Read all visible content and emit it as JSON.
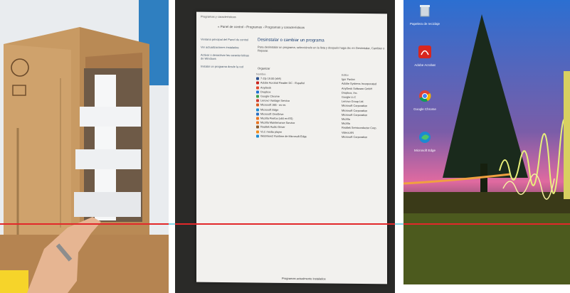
{
  "panels": {
    "control_panel": {
      "title": "Programas y características",
      "breadcrumb": "« Panel de control › Programas › Programas y características",
      "sidebar": [
        "Ventana principal del Panel de control",
        "Ver actualizaciones instaladas",
        "Activar o desactivar las características de Windows",
        "Instalar un programa desde la red"
      ],
      "heading": "Desinstalar o cambiar un programa",
      "description": "Para desinstalar un programa, selecciónelo en la lista y después haga clic en Desinstalar, Cambiar o Reparar.",
      "organize": "Organizar",
      "col_name": "Nombre",
      "col_publisher": "Editor",
      "programs": [
        {
          "name": "7-Zip 19.00 (x64)",
          "publisher": "Igor Pavlov",
          "color": "#2b4e8c"
        },
        {
          "name": "Adobe Acrobat Reader DC - Español",
          "publisher": "Adobe Systems Incorporated",
          "color": "#c8221c"
        },
        {
          "name": "AnyDesk",
          "publisher": "AnyDesk Software GmbH",
          "color": "#e0472b"
        },
        {
          "name": "Dropbox",
          "publisher": "Dropbox, Inc.",
          "color": "#1f6fd1"
        },
        {
          "name": "Google Chrome",
          "publisher": "Google LLC",
          "color": "#3b9e4a"
        },
        {
          "name": "Lenovo Vantage Service",
          "publisher": "Lenovo Group Ltd.",
          "color": "#d13a2f"
        },
        {
          "name": "Microsoft 365 - es-es",
          "publisher": "Microsoft Corporation",
          "color": "#d95b1f"
        },
        {
          "name": "Microsoft Edge",
          "publisher": "Microsoft Corporation",
          "color": "#1c8ad1"
        },
        {
          "name": "Microsoft OneDrive",
          "publisher": "Microsoft Corporation",
          "color": "#2a6fc2"
        },
        {
          "name": "Mozilla Firefox (x64 es-ES)",
          "publisher": "Mozilla",
          "color": "#e8731f"
        },
        {
          "name": "Mozilla Maintenance Service",
          "publisher": "Mozilla",
          "color": "#e8731f"
        },
        {
          "name": "Realtek Audio Driver",
          "publisher": "Realtek Semiconductor Corp.",
          "color": "#8a5a2b"
        },
        {
          "name": "VLC media player",
          "publisher": "VideoLAN",
          "color": "#ef8a1c"
        },
        {
          "name": "WebView2 Runtime de Microsoft Edge",
          "publisher": "Microsoft Corporation",
          "color": "#1c8ad1"
        }
      ],
      "status": "Programas actualmente instalados"
    },
    "desktop": {
      "icons": [
        {
          "label": "Papelera de reciclaje",
          "icon": "recycle-bin-icon"
        },
        {
          "label": "Adobe Acrobat",
          "icon": "acrobat-icon"
        },
        {
          "label": "Google Chrome",
          "icon": "chrome-icon"
        },
        {
          "label": "Microsoft Edge",
          "icon": "edge-icon"
        }
      ]
    }
  }
}
